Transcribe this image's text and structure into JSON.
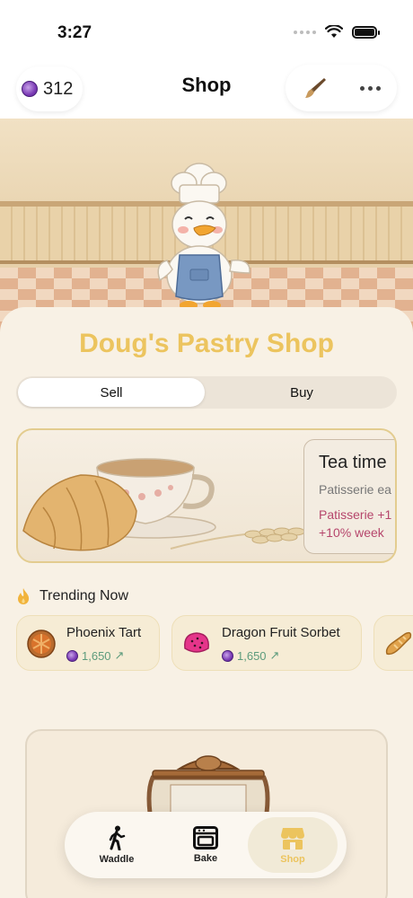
{
  "status": {
    "time": "3:27"
  },
  "header": {
    "coins": "312",
    "title": "Shop"
  },
  "shop": {
    "title": "Doug's Pastry Shop",
    "tabs": [
      {
        "label": "Sell",
        "selected": true
      },
      {
        "label": "Buy",
        "selected": false
      }
    ]
  },
  "featured": {
    "title": "Tea time",
    "subtitle": "Patisserie ea",
    "bonus_line1": "Patisserie +1",
    "bonus_line2": "+10% week"
  },
  "trending": {
    "title": "Trending Now",
    "items": [
      {
        "name": "Phoenix Tart",
        "price": "1,650",
        "trend": "up"
      },
      {
        "name": "Dragon Fruit Sorbet",
        "price": "1,650",
        "trend": "up"
      }
    ]
  },
  "tabbar": {
    "items": [
      {
        "label": "Waddle",
        "icon": "walking-person-icon"
      },
      {
        "label": "Bake",
        "icon": "oven-icon"
      },
      {
        "label": "Shop",
        "icon": "storefront-icon",
        "active": true
      }
    ],
    "active_color": "#ecc45e"
  },
  "colors": {
    "accent_gold": "#ecc45e",
    "bonus_pink": "#b6466c",
    "price_green": "#5c9b7c",
    "gem_purple": "#7b3bb5"
  }
}
